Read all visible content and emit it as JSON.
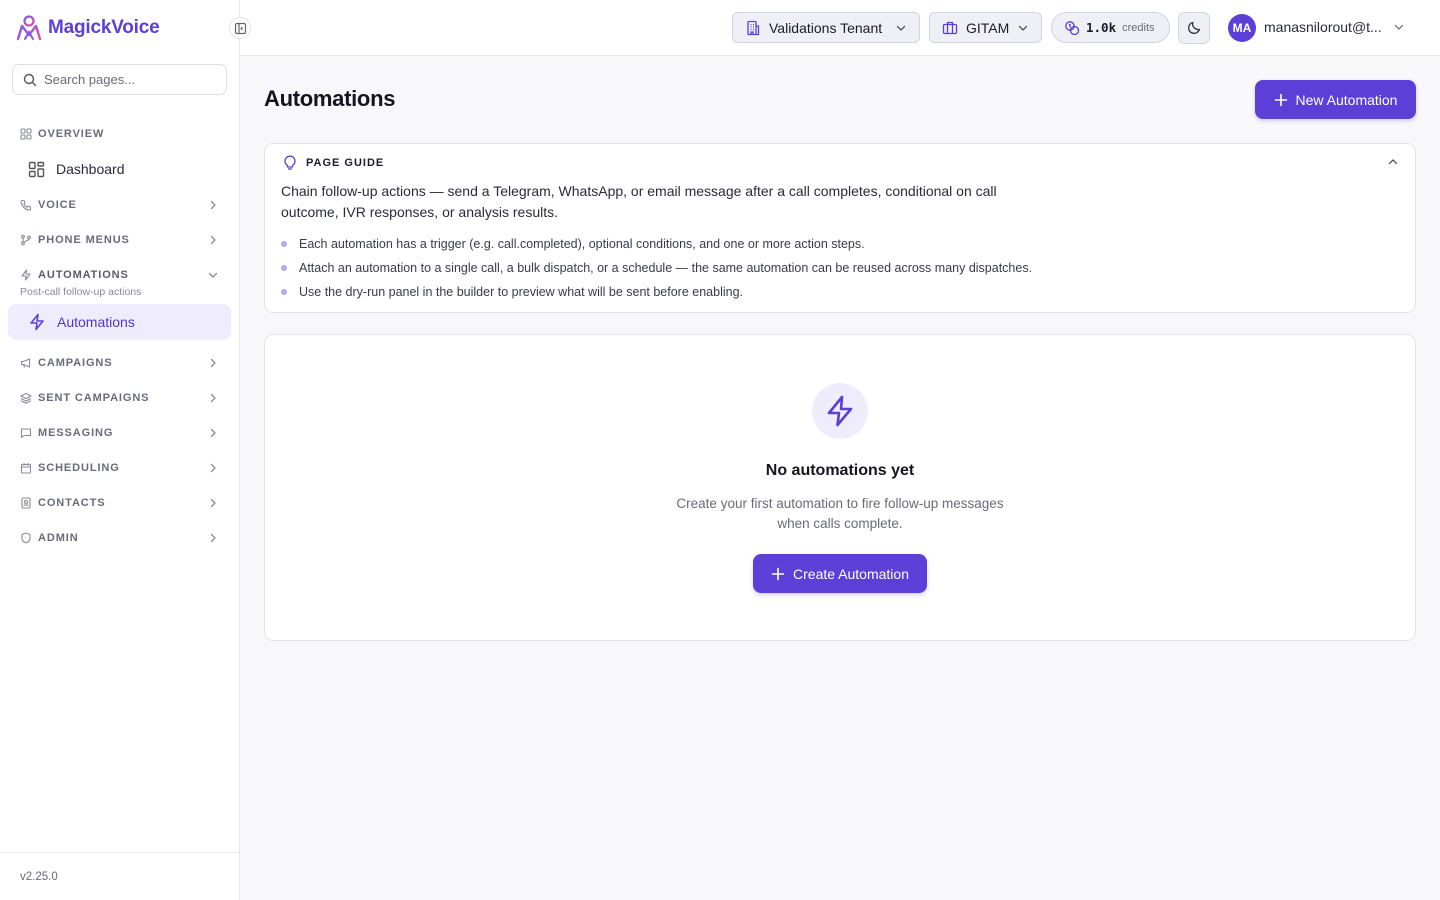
{
  "app": {
    "name": "MagickVoice",
    "version": "v2.25.0"
  },
  "colors": {
    "accent": "#5b3fd6",
    "accent_soft": "#efecfc",
    "pill_bg": "#eef0f6"
  },
  "sidebar": {
    "search_placeholder": "Search pages...",
    "sections": [
      {
        "label": "OVERVIEW",
        "icon": "grid-icon"
      },
      {
        "label": "VOICE",
        "icon": "phone-icon"
      },
      {
        "label": "PHONE MENUS",
        "icon": "branch-icon"
      },
      {
        "label": "AUTOMATIONS",
        "icon": "bolt-icon",
        "subtitle": "Post-call follow-up actions"
      },
      {
        "label": "CAMPAIGNS",
        "icon": "megaphone-icon"
      },
      {
        "label": "SENT CAMPAIGNS",
        "icon": "layers-icon"
      },
      {
        "label": "MESSAGING",
        "icon": "message-icon"
      },
      {
        "label": "SCHEDULING",
        "icon": "calendar-icon"
      },
      {
        "label": "CONTACTS",
        "icon": "contact-icon"
      },
      {
        "label": "ADMIN",
        "icon": "shield-icon"
      }
    ],
    "items": {
      "dashboard": "Dashboard",
      "automations": "Automations"
    }
  },
  "topbar": {
    "tenant": "Validations Tenant",
    "org": "GITAM",
    "credits_value": "1.0k",
    "credits_unit": "credits",
    "avatar_initials": "MA",
    "user_name": "manasnilorout@t..."
  },
  "main": {
    "title": "Automations",
    "new_button": "New Automation",
    "guide": {
      "title": "PAGE GUIDE",
      "description": "Chain follow-up actions — send a Telegram, WhatsApp, or email message after a call completes, conditional on call outcome, IVR responses, or analysis results.",
      "bullets": [
        "Each automation has a trigger (e.g. call.completed), optional conditions, and one or more action steps.",
        "Attach an automation to a single call, a bulk dispatch, or a schedule — the same automation can be reused across many dispatches.",
        "Use the dry-run panel in the builder to preview what will be sent before enabling."
      ]
    },
    "empty": {
      "title": "No automations yet",
      "description": "Create your first automation to fire follow-up messages when calls complete.",
      "button": "Create Automation"
    }
  }
}
